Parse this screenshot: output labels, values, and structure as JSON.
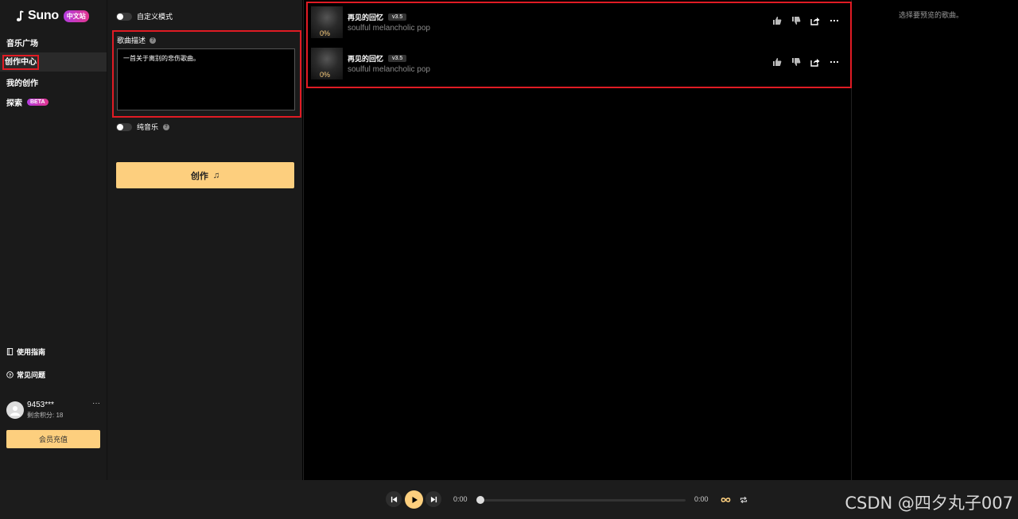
{
  "app": {
    "brand": "Suno",
    "badge": "中文站"
  },
  "sidebar": {
    "items": [
      {
        "label": "音乐广场"
      },
      {
        "label": "创作中心"
      },
      {
        "label": "我的创作"
      },
      {
        "label": "探索",
        "badge": "BETA"
      }
    ],
    "footer": {
      "guide": "使用指南",
      "faq": "常见问题"
    },
    "user": {
      "name": "9453***",
      "credits": "剩余积分: 18",
      "more": "···"
    },
    "recharge_label": "会员充值"
  },
  "create": {
    "custom_mode_label": "自定义模式",
    "desc_label": "歌曲描述",
    "desc_value": "一首关于离别的悲伤歌曲。",
    "instrumental_label": "纯音乐",
    "create_label": "创作"
  },
  "songs": [
    {
      "title": "再见的回忆",
      "version": "v3.5",
      "style": "soulful melancholic pop",
      "progress": "0%"
    },
    {
      "title": "再见的回忆",
      "version": "v3.5",
      "style": "soulful melancholic pop",
      "progress": "0%"
    }
  ],
  "preview": {
    "empty_text": "选择要预览的歌曲。"
  },
  "player": {
    "current_time": "0:00",
    "total_time": "0:00",
    "progress": 0
  },
  "watermark": "CSDN @四夕丸子007",
  "colors": {
    "accent": "#fdcf7e",
    "highlight": "#e01b24",
    "badge_gradient": [
      "#b43ce0",
      "#e2368f"
    ]
  }
}
